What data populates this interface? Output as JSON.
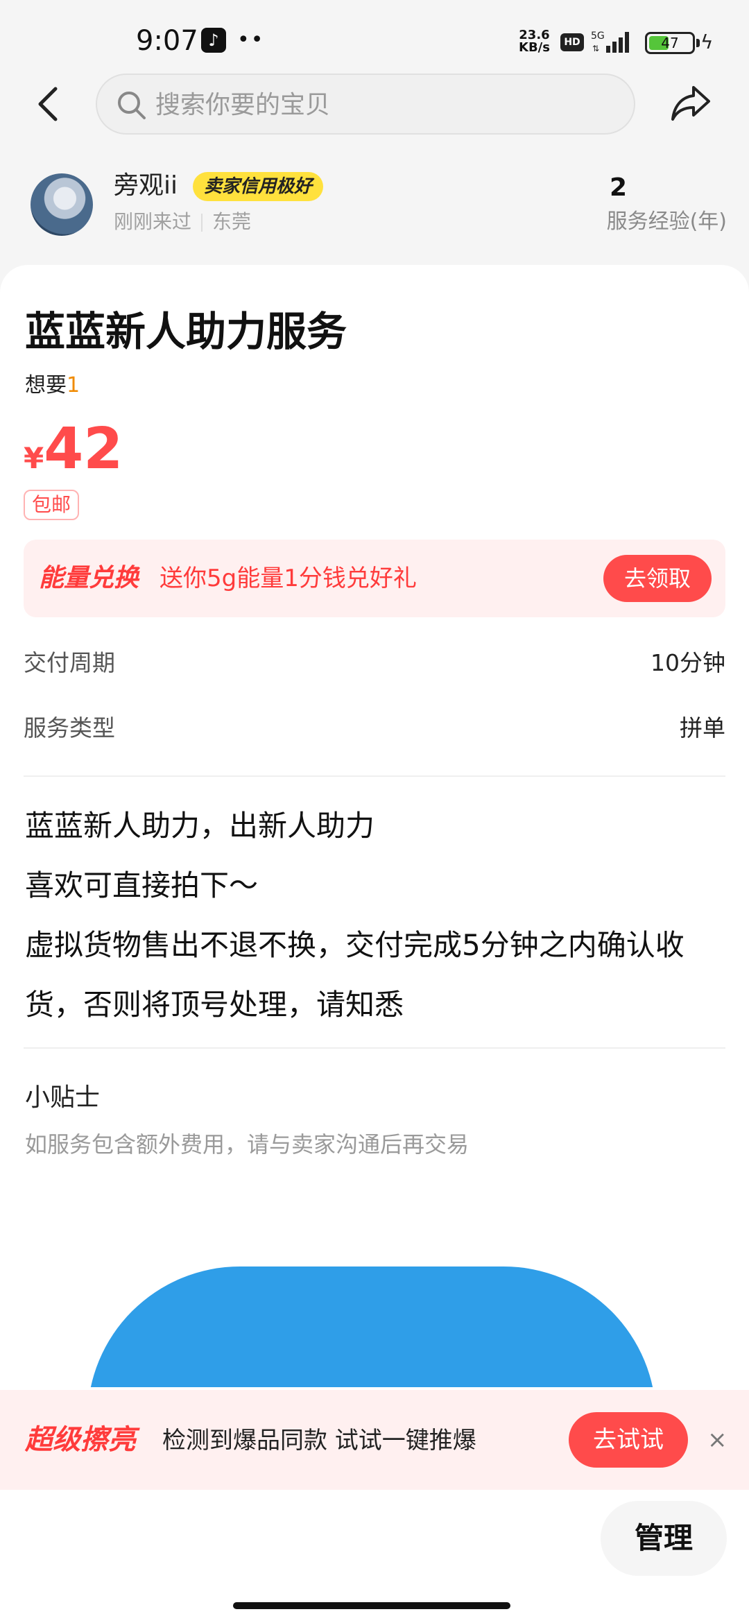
{
  "status_bar": {
    "time": "9:07",
    "dots": "••",
    "net_speed_value": "23.6",
    "net_speed_unit": "KB/s",
    "hd": "HD",
    "network": "5G",
    "battery_level": 47,
    "battery": "47"
  },
  "search": {
    "placeholder": "搜索你要的宝贝"
  },
  "seller": {
    "name": "旁观ii",
    "credit_badge": "卖家信用极好",
    "last_seen": "刚刚来过",
    "location": "东莞",
    "experience_years": "2",
    "experience_label": "服务经验(年)"
  },
  "product": {
    "title": "蓝蓝新人助力服务",
    "want_label": "想要",
    "want_count": "1",
    "price_symbol": "¥",
    "price": "42",
    "free_shipping": "包邮"
  },
  "energy_banner": {
    "title": "能量兑换",
    "text": "送你5g能量1分钱兑好礼",
    "button": "去领取"
  },
  "attributes": [
    {
      "label": "交付周期",
      "value": "10分钟"
    },
    {
      "label": "服务类型",
      "value": "拼单"
    }
  ],
  "description": [
    "蓝蓝新人助力，出新人助力",
    "喜欢可直接拍下～",
    "虚拟货物售出不退不换，交付完成5分钟之内确认收货，否则将顶号处理，请知悉"
  ],
  "tips": {
    "title": "小贴士",
    "text": "如服务包含额外费用，请与卖家沟通后再交易"
  },
  "boost_banner": {
    "title": "超级擦亮",
    "text": "检测到爆品同款 试试一键推爆",
    "button": "去试试",
    "close": "×"
  },
  "manage_button": "管理",
  "colors": {
    "accent_red": "#ff4b4b",
    "credit_yellow": "#ffe13d",
    "banner_bg": "#fff0f0"
  }
}
